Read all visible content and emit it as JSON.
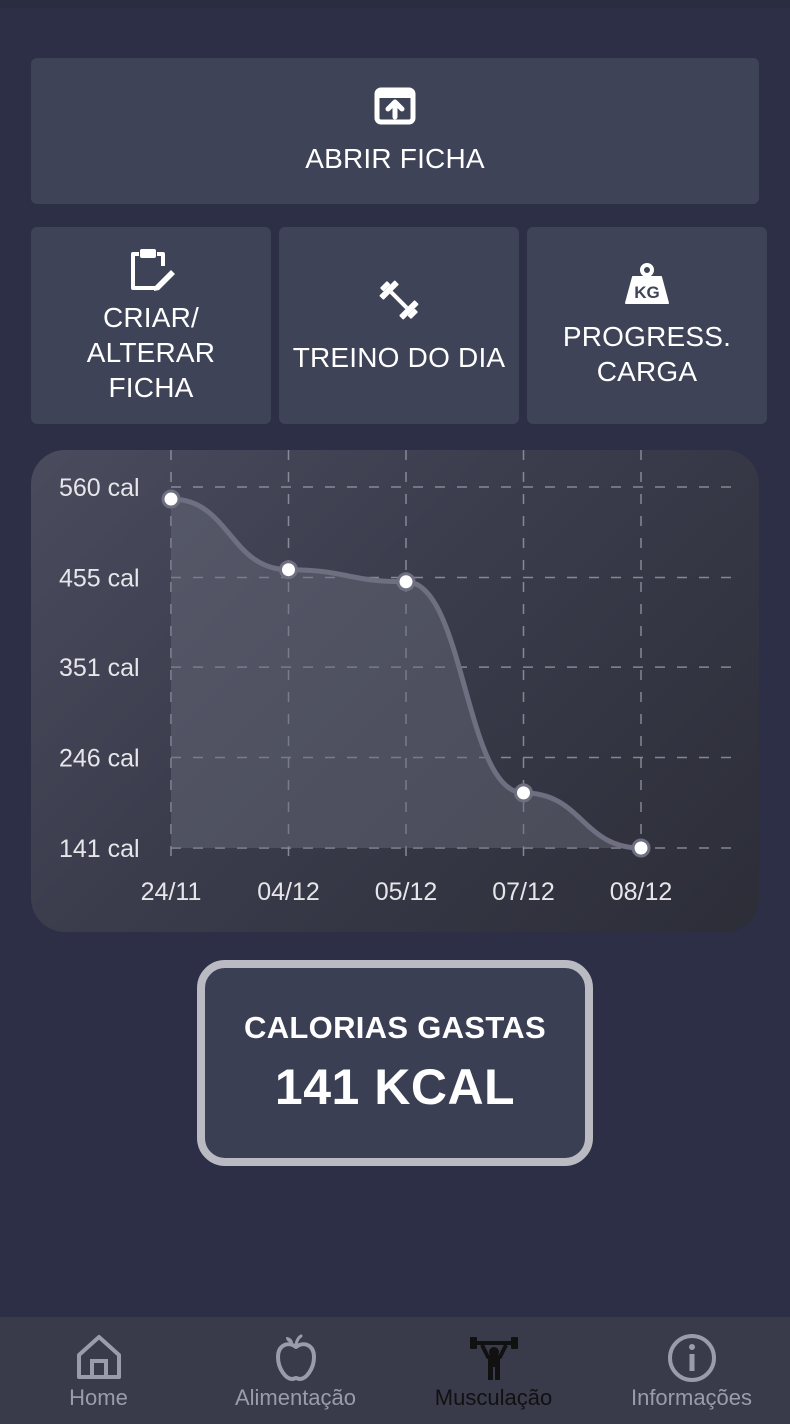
{
  "actions": {
    "open_sheet": "ABRIR FICHA",
    "create_sheet_line1": "CRIAR/",
    "create_sheet_line2": "ALTERAR",
    "create_sheet_line3": "FICHA",
    "daily_workout": "TREINO DO DIA",
    "load_progress_line1": "PROGRESS.",
    "load_progress_line2": "CARGA"
  },
  "chart_data": {
    "type": "area",
    "x": [
      "24/11",
      "04/12",
      "05/12",
      "07/12",
      "08/12"
    ],
    "values": [
      546,
      464,
      450,
      205,
      141
    ],
    "y_ticks": [
      "560 cal",
      "455 cal",
      "351 cal",
      "246 cal",
      "141 cal"
    ],
    "y_tick_values": [
      560,
      455,
      351,
      246,
      141
    ],
    "ylim": [
      141,
      560
    ],
    "grid": true,
    "title": "",
    "xlabel": "",
    "ylabel": ""
  },
  "calories": {
    "title": "CALORIAS GASTAS",
    "value": "141 KCAL"
  },
  "nav": {
    "items": [
      {
        "label": "Home",
        "icon": "home-icon"
      },
      {
        "label": "Alimentação",
        "icon": "apple-icon"
      },
      {
        "label": "Musculação",
        "icon": "weightlifter-icon"
      },
      {
        "label": "Informações",
        "icon": "info-icon"
      }
    ],
    "active": "Musculação"
  },
  "colors": {
    "background": "#2c2f45",
    "tile": "#3f4357",
    "nav_active": "#111111",
    "nav_inactive": "#9a9cad"
  }
}
